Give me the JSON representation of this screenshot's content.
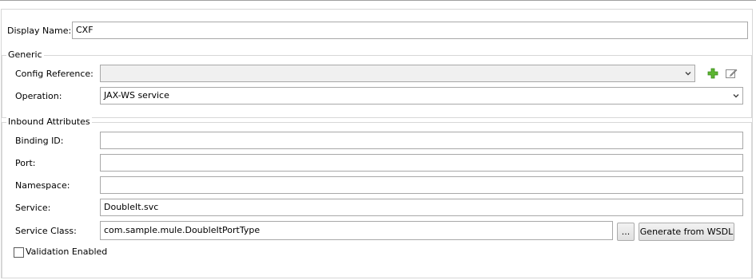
{
  "display_name": {
    "label": "Display Name:",
    "value": "CXF"
  },
  "generic": {
    "title": "Generic",
    "config_reference": {
      "label": "Config Reference:",
      "value": ""
    },
    "add_icon": "add-icon",
    "edit_icon": "edit-icon",
    "operation": {
      "label": "Operation:",
      "value": "JAX-WS service"
    }
  },
  "inbound": {
    "title": "Inbound Attributes",
    "binding_id": {
      "label": "Binding ID:",
      "value": ""
    },
    "port": {
      "label": "Port:",
      "value": ""
    },
    "namespace": {
      "label": "Namespace:",
      "value": ""
    },
    "service": {
      "label": "Service:",
      "value": "DoubleIt.svc"
    },
    "service_class": {
      "label": "Service Class:",
      "value": "com.sample.mule.DoubleItPortType",
      "browse_label": "...",
      "generate_label": "Generate from WSDL"
    },
    "validation": {
      "label": "Validation Enabled",
      "checked": false
    }
  },
  "colors": {
    "add_icon_green": "#5cb531",
    "border": "#a8a8a8",
    "group_border": "#d7d7d7"
  }
}
